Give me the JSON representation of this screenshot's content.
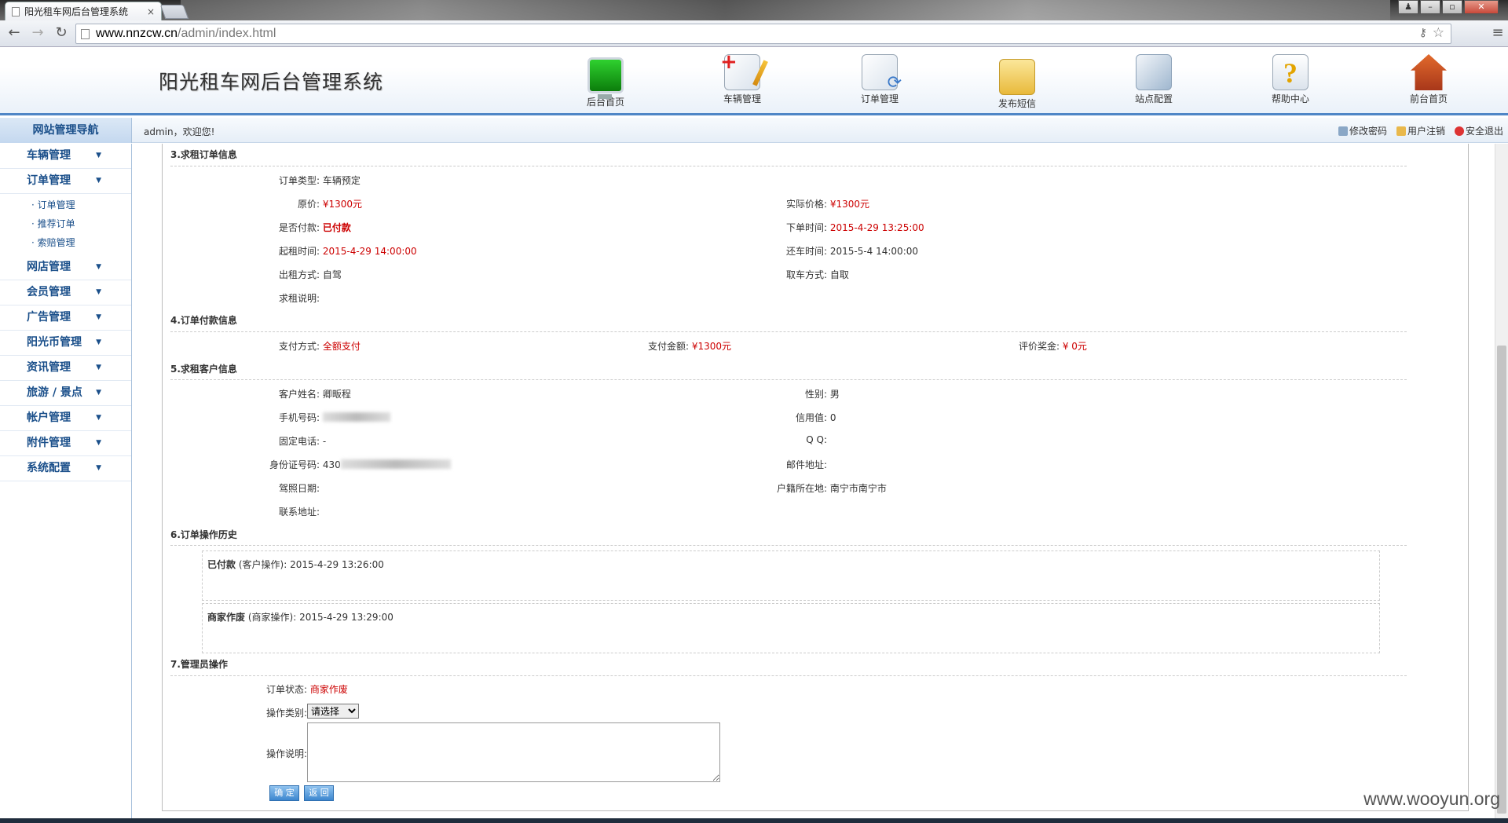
{
  "browser": {
    "tab_title": "阳光租车网后台管理系统",
    "tab_close": "×",
    "url_host": "www.nnzcw.cn",
    "url_path": "/admin/index.html"
  },
  "header": {
    "app_title": "阳光租车网后台管理系统",
    "nav": [
      {
        "label": "后台首页",
        "icon": "monitor-icon"
      },
      {
        "label": "车辆管理",
        "icon": "document-add-icon"
      },
      {
        "label": "订单管理",
        "icon": "document-refresh-icon"
      },
      {
        "label": "发布短信",
        "icon": "mail-icon"
      },
      {
        "label": "站点配置",
        "icon": "gear-icon"
      },
      {
        "label": "帮助中心",
        "icon": "help-icon"
      },
      {
        "label": "前台首页",
        "icon": "house-icon"
      }
    ]
  },
  "subbar": {
    "nav_title": "网站管理导航",
    "welcome": "admin，欢迎您!",
    "links": [
      "修改密码",
      "用户注销",
      "安全退出"
    ]
  },
  "sidebar": {
    "items": [
      {
        "label": "车辆管理"
      },
      {
        "label": "订单管理"
      },
      {
        "label": "网店管理"
      },
      {
        "label": "会员管理"
      },
      {
        "label": "广告管理"
      },
      {
        "label": "阳光币管理"
      },
      {
        "label": "资讯管理"
      },
      {
        "label": "旅游 / 景点"
      },
      {
        "label": "帐户管理"
      },
      {
        "label": "附件管理"
      },
      {
        "label": "系统配置"
      }
    ],
    "order_sub": [
      "· 订单管理",
      "· 推荐订单",
      "· 索赔管理"
    ]
  },
  "sections": {
    "s3": "3.求租订单信息",
    "s4": "4.订单付款信息",
    "s5": "5.求租客户信息",
    "s6": "6.订单操作历史",
    "s7": "7.管理员操作"
  },
  "order": {
    "type_label": "订单类型:",
    "type": "车辆预定",
    "orig_price_label": "原价:",
    "orig_price": "¥1300元",
    "actual_price_label": "实际价格:",
    "actual_price": "¥1300元",
    "paid_label": "是否付款:",
    "paid": "已付款",
    "order_time_label": "下单时间:",
    "order_time": "2015-4-29 13:25:00",
    "start_label": "起租时间:",
    "start": "2015-4-29 14:00:00",
    "return_label": "还车时间:",
    "return": "2015-5-4 14:00:00",
    "rent_mode_label": "出租方式:",
    "rent_mode": "自驾",
    "pickup_label": "取车方式:",
    "pickup": "自取",
    "note_label": "求租说明:",
    "note": ""
  },
  "payment": {
    "method_label": "支付方式:",
    "method": "全额支付",
    "amount_label": "支付金额:",
    "amount": "¥1300元",
    "bonus_label": "评价奖金:",
    "bonus": "¥ 0元"
  },
  "customer": {
    "name_label": "客户姓名:",
    "name": "卿畈程",
    "gender_label": "性别:",
    "gender": "男",
    "phone_label": "手机号码:",
    "credit_label": "信用值:",
    "credit": "0",
    "tel_label": "固定电话:",
    "tel": "-",
    "qq_label": "Q Q:",
    "qq": "",
    "id_label": "身份证号码:",
    "id_prefix": "430",
    "email_label": "邮件地址:",
    "email": "",
    "license_label": "驾照日期:",
    "license": "",
    "hukou_label": "户籍所在地:",
    "hukou": "南宁市南宁市",
    "address_label": "联系地址:",
    "address": ""
  },
  "history": [
    {
      "action": "已付款",
      "actor": " (客户操作): ",
      "time": "2015-4-29 13:26:00"
    },
    {
      "action": "商家作废",
      "actor": " (商家操作): ",
      "time": "2015-4-29 13:29:00"
    }
  ],
  "admin_op": {
    "status_label": "订单状态:",
    "status": "商家作废",
    "type_label": "操作类别:",
    "type_selected": "请选择",
    "desc_label": "操作说明:",
    "confirm": "确 定",
    "back": "返 回"
  },
  "watermark": "www.wooyun.org"
}
